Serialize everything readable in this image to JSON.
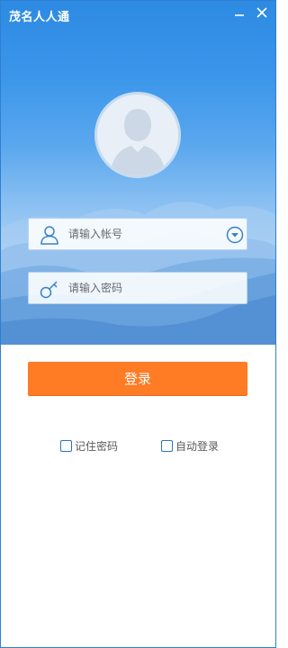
{
  "window": {
    "title": "茂名人人通"
  },
  "controls": {
    "minimize_icon": "minimize-icon",
    "close_icon": "close-icon"
  },
  "avatar": {
    "icon": "user-silhouette-icon"
  },
  "account": {
    "placeholder": "请输入帐号",
    "icon": "user-icon",
    "dropdown_icon": "chevron-down-icon"
  },
  "password": {
    "placeholder": "请输入密码",
    "icon": "key-icon"
  },
  "login_button": {
    "label": "登录"
  },
  "options": {
    "remember_password": "记住密码",
    "auto_login": "自动登录"
  },
  "colors": {
    "title_bar": "#2d8ae2",
    "login_button": "#ff7b24",
    "checkbox_border": "#2a72c4",
    "icon_blue": "#3a82c4"
  }
}
